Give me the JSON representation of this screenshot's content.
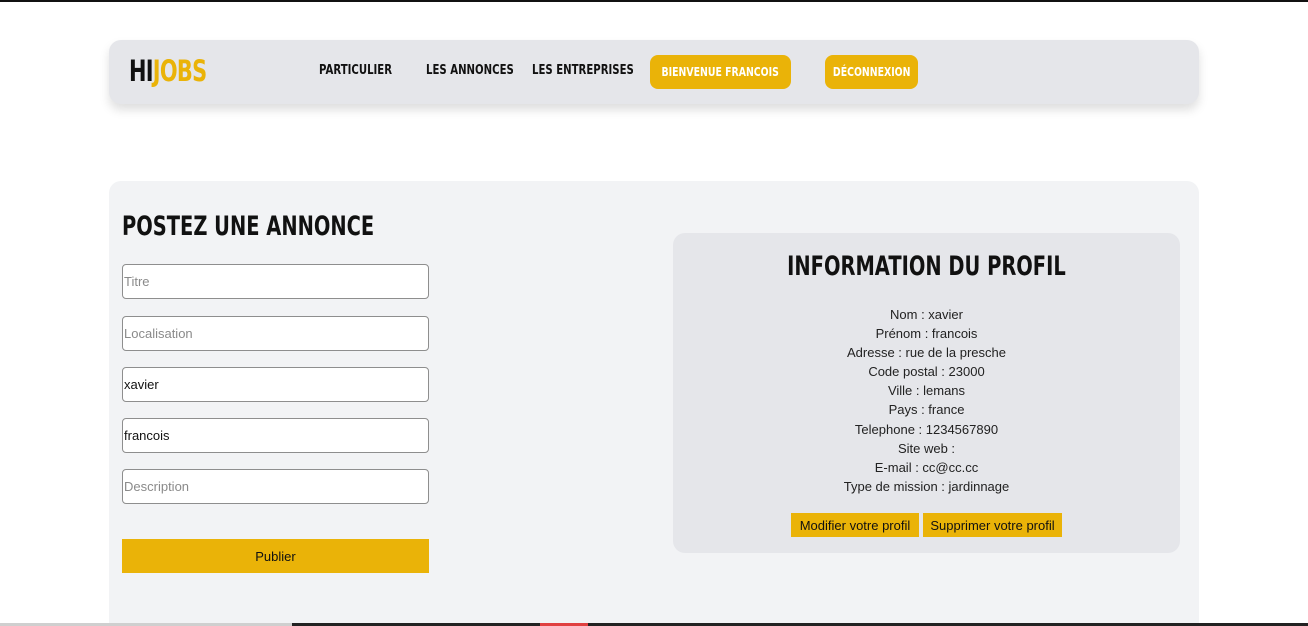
{
  "nav": {
    "logo_part1": "HI",
    "logo_part2": "JOBS",
    "links": [
      "PARTICULIER",
      "LES ANNONCES",
      "LES ENTREPRISES"
    ],
    "welcome_button": "BIENVENUE FRANCOIS",
    "logout_button": "DÉCONNEXION"
  },
  "form": {
    "title": "POSTEZ UNE ANNONCE",
    "fields": [
      {
        "placeholder": "Titre",
        "value": ""
      },
      {
        "placeholder": "Localisation",
        "value": ""
      },
      {
        "placeholder": "",
        "value": "xavier"
      },
      {
        "placeholder": "",
        "value": "francois"
      },
      {
        "placeholder": "Description",
        "value": ""
      }
    ],
    "submit_label": "Publier"
  },
  "profile": {
    "title": "INFORMATION DU PROFIL",
    "lines": [
      "Nom : xavier",
      "Prénom : francois",
      "Adresse : rue de la presche",
      "Code postal : 23000",
      "Ville : lemans",
      "Pays : france",
      "Telephone : 1234567890",
      "Site web :",
      "E-mail : cc@cc.cc",
      "Type de mission : jardinnage"
    ],
    "edit_button": "Modifier votre profil",
    "delete_button": "Supprimer votre profil"
  },
  "colors": {
    "accent": "#eab308",
    "navbar_bg": "#e5e6ea",
    "panel_bg": "#f2f3f5"
  }
}
